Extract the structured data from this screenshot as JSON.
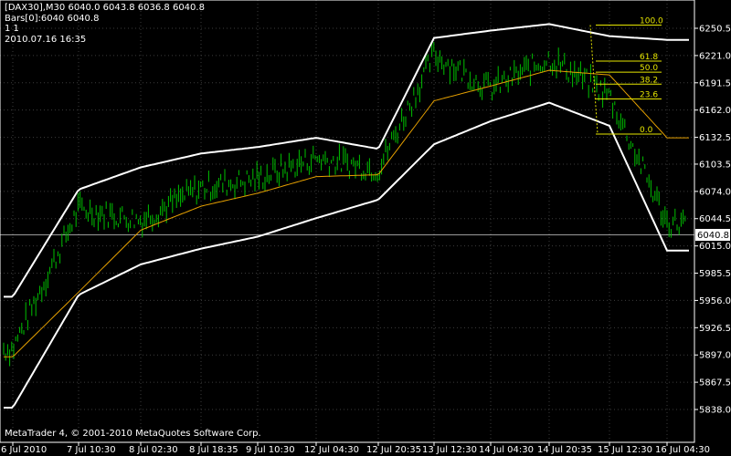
{
  "info": {
    "line1": "[DAX30],M30  6040.0 6043.8 6036.8 6040.8",
    "line2": "Bars[0]:6040 6040.8",
    "line3": "1 1",
    "line4": "2010.07.16 16:35"
  },
  "copyright": "MetaTrader 4, © 2001-2010 MetaQuotes Software Corp.",
  "current_price_label": "6040.8",
  "colors": {
    "background": "#000000",
    "candles": "#00c000",
    "bands": "#ffffff",
    "moving_average": "#e6a000",
    "fibonacci": "#e6e600",
    "axis": "#ffffff",
    "grid": "#3c3c3c"
  },
  "chart_data": {
    "type": "line",
    "title": "[DAX30],M30",
    "symbol": "DAX30",
    "timeframe": "M30",
    "y_ticks": [
      "6250.5",
      "6221.0",
      "6191.5",
      "6162.0",
      "6132.5",
      "6103.5",
      "6074.0",
      "6044.5",
      "6015.0",
      "5985.5",
      "5956.0",
      "5926.5",
      "5897.0",
      "5867.5",
      "5838.0"
    ],
    "x_ticks": [
      "6 Jul 2010",
      "7 Jul 10:30",
      "8 Jul 02:30",
      "8 Jul 18:35",
      "9 Jul 10:30",
      "12 Jul 04:30",
      "12 Jul 20:35",
      "13 Jul 12:30",
      "14 Jul 04:30",
      "14 Jul 20:35",
      "15 Jul 12:30",
      "16 Jul 04:30"
    ],
    "ylim": [
      5833,
      6265
    ],
    "grid": true,
    "current_price": 6040.8,
    "x": [
      0,
      1,
      2,
      3,
      4,
      5,
      6,
      7,
      8,
      9,
      10,
      11
    ],
    "series": [
      {
        "name": "Close",
        "values": [
          5904,
          6055,
          6043,
          6078,
          6088,
          6110,
          6098,
          6222,
          6185,
          6218,
          6178,
          6040
        ]
      },
      {
        "name": "Upper band",
        "values": [
          5960,
          6076,
          6100,
          6115,
          6122,
          6132,
          6120,
          6240,
          6248,
          6255,
          6242,
          6238
        ]
      },
      {
        "name": "Lower band",
        "values": [
          5840,
          5962,
          5995,
          6012,
          6025,
          6045,
          6065,
          6125,
          6150,
          6170,
          6145,
          6010
        ]
      },
      {
        "name": "Moving average",
        "values": [
          5895,
          5965,
          6032,
          6058,
          6072,
          6090,
          6092,
          6172,
          6188,
          6205,
          6200,
          6132
        ]
      }
    ],
    "fibonacci": {
      "levels": [
        "100.0",
        "61.8",
        "50.0",
        "38.2",
        "23.6",
        "0.0"
      ],
      "prices": [
        6254,
        6215,
        6203,
        6190,
        6174,
        6136
      ]
    }
  }
}
